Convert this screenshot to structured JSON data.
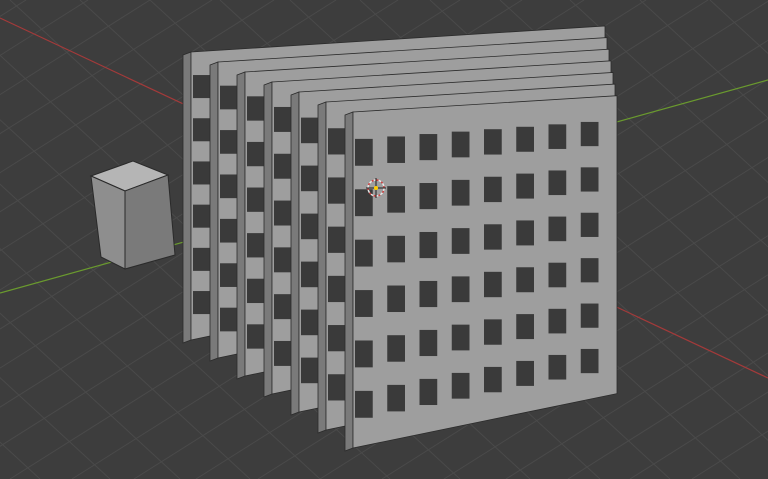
{
  "viewport": {
    "background_color": "#3d3d3d",
    "grid_color": "#4a4a4a",
    "x_axis_color": "#a33a3a",
    "y_axis_color": "#6a9a2e"
  },
  "objects": {
    "cube": {
      "name": "cube",
      "face_light": "#b5b5b5",
      "face_mid": "#8e8e8e",
      "face_dark": "#7a7a7a",
      "edge_color": "#2a2a2a"
    },
    "building_array": {
      "name": "building-array",
      "panel_count": 7,
      "floors": 6,
      "face_light": "#9e9e9e",
      "face_dark": "#7a7a7a",
      "window_color": "#3a3a3a"
    },
    "cursor_3d": {
      "name": "3d-cursor-icon",
      "ring_color": "#e8e8e8",
      "accent_color": "#d04040"
    }
  }
}
